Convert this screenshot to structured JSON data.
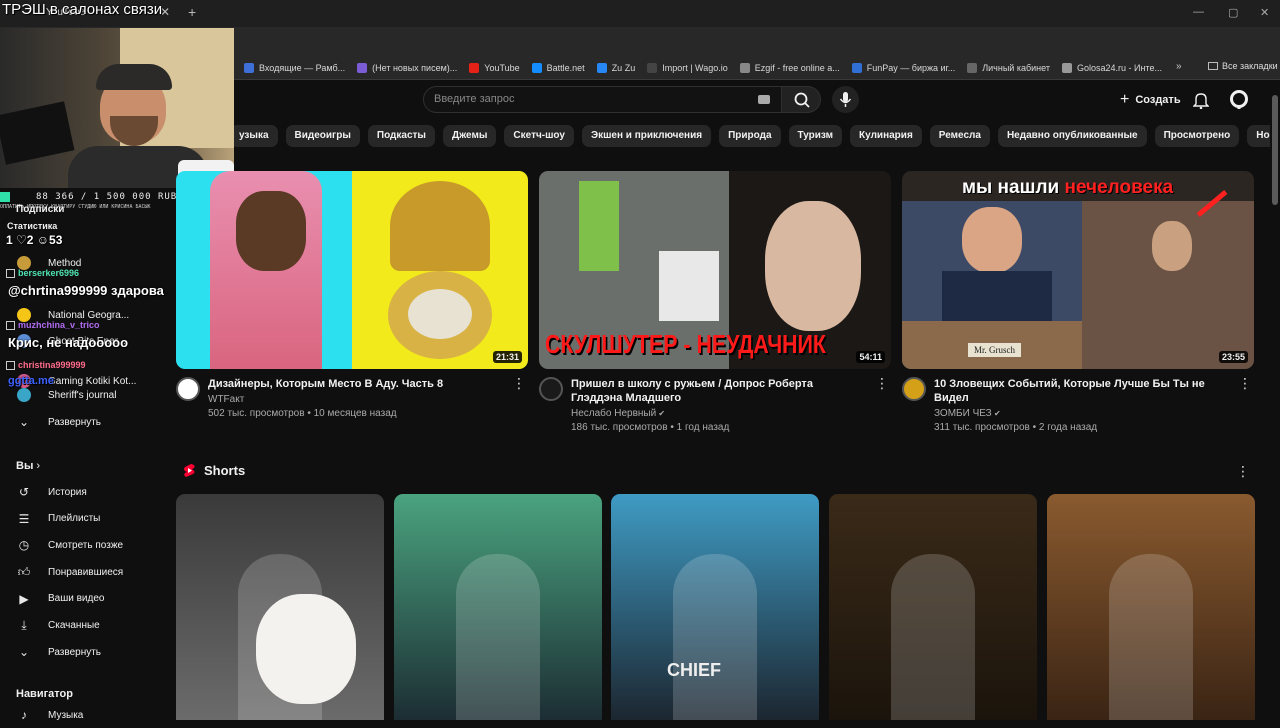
{
  "browser": {
    "tab_title": "YouTube",
    "stream_overlay_title": "ТРЭШ в салонах связи",
    "bookmarks": [
      {
        "label": "Входящие — Рамб...",
        "color": "#3d6fd6"
      },
      {
        "label": "(Нет новых писем)...",
        "color": "#7b5cd6"
      },
      {
        "label": "YouTube",
        "color": "#e62117"
      },
      {
        "label": "Battle.net",
        "color": "#148eff"
      },
      {
        "label": "Zu Zu",
        "color": "#2787f5"
      },
      {
        "label": "Import | Wago.io",
        "color": "#444444"
      },
      {
        "label": "Ezgif - free online a...",
        "color": "#888888"
      },
      {
        "label": "FunPay — биржа иг...",
        "color": "#2f6fd6"
      },
      {
        "label": "Личный кабинет",
        "color": "#666666"
      },
      {
        "label": "Golosa24.ru - Инте...",
        "color": "#999999"
      }
    ],
    "bookmarks_more": "»",
    "all_bookmarks": "Все закладки"
  },
  "header": {
    "search_placeholder": "Введите запрос",
    "create_label": "Создать"
  },
  "chips": [
    "узыка",
    "Видеоигры",
    "Подкасты",
    "Джемы",
    "Скетч-шоу",
    "Экшен и приключения",
    "Природа",
    "Туризм",
    "Кулинария",
    "Ремесла",
    "Недавно опубликованные",
    "Просмотрено",
    "Новое для вас"
  ],
  "sidebar": {
    "subs_heading": "Подписки",
    "subscriptions": [
      {
        "name": "Method",
        "color": "#c79a3a"
      },
      {
        "name": "National Geogra...",
        "color": "#f5c518"
      },
      {
        "name": "Ghost Bits Ener...",
        "color": "#5c8ed6"
      },
      {
        "name": "Gaming Kotiki Kot...",
        "color": "#d65c8e"
      },
      {
        "name": "Sheriff's journal",
        "color": "#3aa6c7"
      }
    ],
    "expand_subs": "Развернуть",
    "you_heading": "Вы",
    "you_items": [
      {
        "label": "История",
        "icon": "history-icon"
      },
      {
        "label": "Плейлисты",
        "icon": "playlist-icon"
      },
      {
        "label": "Смотреть позже",
        "icon": "clock-icon"
      },
      {
        "label": "Понравившиеся",
        "icon": "thumb-up-icon"
      },
      {
        "label": "Ваши видео",
        "icon": "video-icon"
      },
      {
        "label": "Скачанные",
        "icon": "download-icon"
      },
      {
        "label": "Развернуть",
        "icon": "chevron-down-icon"
      }
    ],
    "nav_heading": "Навигатор",
    "nav_items": [
      {
        "label": "Музыка",
        "icon": "music-icon"
      }
    ]
  },
  "overlay": {
    "goal": "88 366 / 1 500 000 RUB",
    "goal_subtitle": "ОПЛАТИТЬ ИПОТЕКУ КВАРТИРУ СТУДИЮ ИЛИ КРИСИНА БАСЫК",
    "stats_label": "Статистика",
    "stats_row": "1 ♡2 ☺53",
    "chat": [
      {
        "user": "berserker6996",
        "color": "#4fe3b0",
        "message": "@chrtina999999 здарова"
      },
      {
        "user": "muzhchina_v_trico",
        "color": "#b06cf0",
        "message": "Крис, не надооооо"
      },
      {
        "user": "christina999999",
        "color": "#ff6b8b",
        "message": "ggtta.me"
      }
    ]
  },
  "videos": [
    {
      "title": "Дизайнеры, Которым Место В Аду. Часть 8",
      "channel": "WTFакт",
      "verified": false,
      "views": "502 тыс. просмотров",
      "age": "10 месяцев назад",
      "duration": "21:31",
      "avatar_color": "#ffffff"
    },
    {
      "title": "Пришел в школу с ружьем / Допрос Роберта Глэддэна Младшего",
      "channel": "Неслабо Нервный",
      "verified": true,
      "views": "186 тыс. просмотров",
      "age": "1 год назад",
      "duration": "54:11",
      "thumb_caption": "СКУЛШУТЕР - НЕУДАЧНИК",
      "avatar_color": "#1a1a1a"
    },
    {
      "title": "10 Зловещих Событий, Которые Лучше Бы Ты не Видел",
      "channel": "ЗОМБИ ЧЕЗ",
      "verified": true,
      "views": "311 тыс. просмотров",
      "age": "2 года назад",
      "duration": "23:55",
      "thumb_caption_white": "мы нашли",
      "thumb_caption_red": "нечеловека",
      "nameplate": "Mr. Grusch",
      "avatar_color": "#d4a017"
    }
  ],
  "shorts_heading": "Shorts",
  "shorts": [
    {
      "colors": [
        "#3a3a3a",
        "#6b6b6b"
      ]
    },
    {
      "colors": [
        "#4aa37f",
        "#1c2d33"
      ]
    },
    {
      "colors": [
        "#3f9bc4",
        "#1c2630"
      ],
      "jersey": "CHIEF"
    },
    {
      "colors": [
        "#3a2a18",
        "#1b140c"
      ]
    },
    {
      "colors": [
        "#8a5a2f",
        "#3a2414"
      ]
    }
  ]
}
